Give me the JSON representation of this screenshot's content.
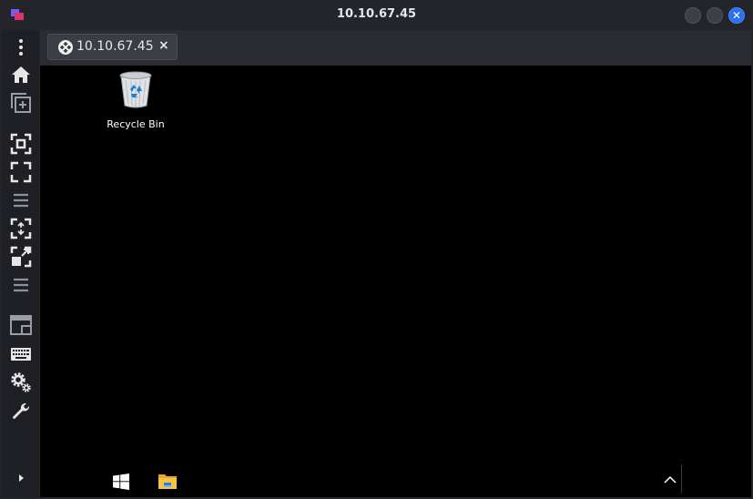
{
  "window": {
    "title": "10.10.67.45",
    "close_glyph": "✕"
  },
  "sidebar": {
    "items": [
      {
        "icon": "more-vertical-icon"
      },
      {
        "icon": "home-icon"
      },
      {
        "icon": "new-connection-icon"
      },
      {
        "icon": "fit-to-screen-icon"
      },
      {
        "icon": "fullscreen-icon"
      },
      {
        "icon": "menu-icon"
      },
      {
        "icon": "resize-icon"
      },
      {
        "icon": "scale-icon"
      },
      {
        "icon": "menu-icon"
      },
      {
        "icon": "display-icon"
      },
      {
        "icon": "keyboard-icon"
      },
      {
        "icon": "settings-icon"
      },
      {
        "icon": "tools-icon"
      },
      {
        "icon": "expand-icon"
      }
    ]
  },
  "tabs": [
    {
      "label": "10.10.67.45",
      "close_glyph": "×",
      "icon": "remote-desktop-icon"
    }
  ],
  "desktop": {
    "icons": [
      {
        "label": "Recycle Bin",
        "icon": "recycle-bin-icon"
      }
    ],
    "taskbar": {
      "items": [
        "windows-start-icon",
        "file-explorer-icon"
      ],
      "tray": [
        "show-hidden-icons-chevron"
      ]
    }
  },
  "colors": {
    "window_bg": "#23252b",
    "sidebar_bg": "#1e2025",
    "tab_bg": "#3a3d44",
    "accent_close": "#2a70f2",
    "remote_bg": "#000000"
  }
}
